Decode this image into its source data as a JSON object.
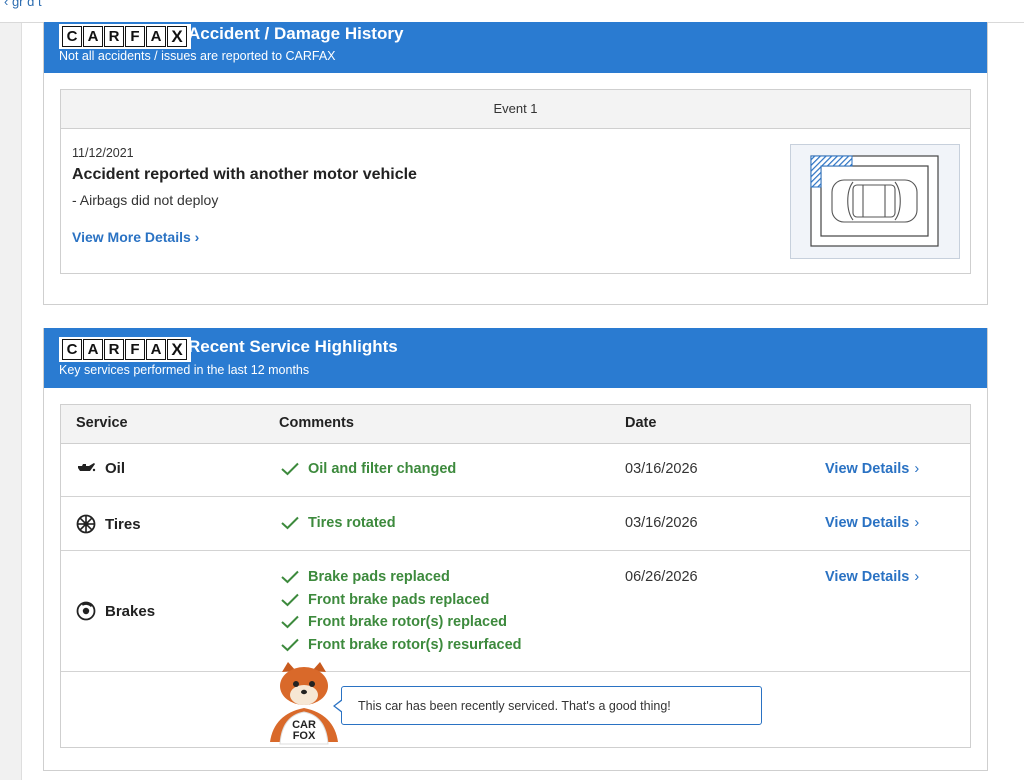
{
  "top_nav": {
    "fragment_text": "‹   gr          d     t"
  },
  "accident": {
    "logo_letters": [
      "C",
      "A",
      "R",
      "F",
      "A",
      "X"
    ],
    "title": "Accident / Damage History",
    "subtitle": "Not all accidents / issues are reported to CARFAX",
    "event_label": "Event 1",
    "date": "11/12/2021",
    "headline": "Accident reported with another motor vehicle",
    "note": "- Airbags did not deploy",
    "link_label": "View More Details ›",
    "colors": {
      "header": "#2a7bd1",
      "link": "#2a72c3",
      "damage": "#2a72c3"
    }
  },
  "service": {
    "logo_letters": [
      "C",
      "A",
      "R",
      "F",
      "A",
      "X"
    ],
    "title": "Recent Service Highlights",
    "subtitle": "Key services performed in the last 12 months",
    "columns": {
      "service": "Service",
      "comments": "Comments",
      "date": "Date"
    },
    "rows": [
      {
        "icon": "oil-can-icon",
        "name": "Oil",
        "comments": [
          "Oil and filter changed"
        ],
        "date": "03/16/2026",
        "link": "View Details"
      },
      {
        "icon": "tire-icon",
        "name": "Tires",
        "comments": [
          "Tires rotated"
        ],
        "date": "03/16/2026",
        "link": "View Details"
      },
      {
        "icon": "brake-disc-icon",
        "name": "Brakes",
        "comments": [
          "Brake pads replaced",
          "Front brake pads replaced",
          "Front brake rotor(s) replaced",
          "Front brake rotor(s) resurfaced"
        ],
        "date": "06/26/2026",
        "link": "View Details"
      }
    ],
    "link_chevron": "›",
    "fox_shirt": [
      "CAR",
      "FOX"
    ],
    "fox_message": "This car has been recently serviced. That's a good thing!",
    "colors": {
      "comment_green": "#3d8a3d",
      "check": "#3d8a3d"
    }
  }
}
